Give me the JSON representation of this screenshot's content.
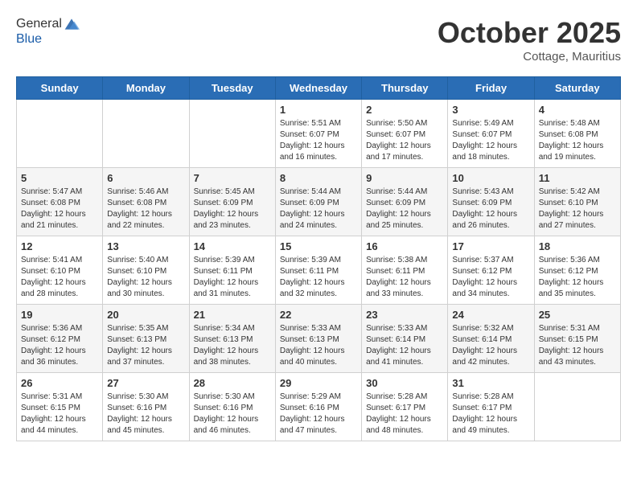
{
  "header": {
    "logo_line1": "General",
    "logo_line2": "Blue",
    "month": "October 2025",
    "location": "Cottage, Mauritius"
  },
  "days_of_week": [
    "Sunday",
    "Monday",
    "Tuesday",
    "Wednesday",
    "Thursday",
    "Friday",
    "Saturday"
  ],
  "weeks": [
    [
      {
        "day": "",
        "info": ""
      },
      {
        "day": "",
        "info": ""
      },
      {
        "day": "",
        "info": ""
      },
      {
        "day": "1",
        "info": "Sunrise: 5:51 AM\nSunset: 6:07 PM\nDaylight: 12 hours\nand 16 minutes."
      },
      {
        "day": "2",
        "info": "Sunrise: 5:50 AM\nSunset: 6:07 PM\nDaylight: 12 hours\nand 17 minutes."
      },
      {
        "day": "3",
        "info": "Sunrise: 5:49 AM\nSunset: 6:07 PM\nDaylight: 12 hours\nand 18 minutes."
      },
      {
        "day": "4",
        "info": "Sunrise: 5:48 AM\nSunset: 6:08 PM\nDaylight: 12 hours\nand 19 minutes."
      }
    ],
    [
      {
        "day": "5",
        "info": "Sunrise: 5:47 AM\nSunset: 6:08 PM\nDaylight: 12 hours\nand 21 minutes."
      },
      {
        "day": "6",
        "info": "Sunrise: 5:46 AM\nSunset: 6:08 PM\nDaylight: 12 hours\nand 22 minutes."
      },
      {
        "day": "7",
        "info": "Sunrise: 5:45 AM\nSunset: 6:09 PM\nDaylight: 12 hours\nand 23 minutes."
      },
      {
        "day": "8",
        "info": "Sunrise: 5:44 AM\nSunset: 6:09 PM\nDaylight: 12 hours\nand 24 minutes."
      },
      {
        "day": "9",
        "info": "Sunrise: 5:44 AM\nSunset: 6:09 PM\nDaylight: 12 hours\nand 25 minutes."
      },
      {
        "day": "10",
        "info": "Sunrise: 5:43 AM\nSunset: 6:09 PM\nDaylight: 12 hours\nand 26 minutes."
      },
      {
        "day": "11",
        "info": "Sunrise: 5:42 AM\nSunset: 6:10 PM\nDaylight: 12 hours\nand 27 minutes."
      }
    ],
    [
      {
        "day": "12",
        "info": "Sunrise: 5:41 AM\nSunset: 6:10 PM\nDaylight: 12 hours\nand 28 minutes."
      },
      {
        "day": "13",
        "info": "Sunrise: 5:40 AM\nSunset: 6:10 PM\nDaylight: 12 hours\nand 30 minutes."
      },
      {
        "day": "14",
        "info": "Sunrise: 5:39 AM\nSunset: 6:11 PM\nDaylight: 12 hours\nand 31 minutes."
      },
      {
        "day": "15",
        "info": "Sunrise: 5:39 AM\nSunset: 6:11 PM\nDaylight: 12 hours\nand 32 minutes."
      },
      {
        "day": "16",
        "info": "Sunrise: 5:38 AM\nSunset: 6:11 PM\nDaylight: 12 hours\nand 33 minutes."
      },
      {
        "day": "17",
        "info": "Sunrise: 5:37 AM\nSunset: 6:12 PM\nDaylight: 12 hours\nand 34 minutes."
      },
      {
        "day": "18",
        "info": "Sunrise: 5:36 AM\nSunset: 6:12 PM\nDaylight: 12 hours\nand 35 minutes."
      }
    ],
    [
      {
        "day": "19",
        "info": "Sunrise: 5:36 AM\nSunset: 6:12 PM\nDaylight: 12 hours\nand 36 minutes."
      },
      {
        "day": "20",
        "info": "Sunrise: 5:35 AM\nSunset: 6:13 PM\nDaylight: 12 hours\nand 37 minutes."
      },
      {
        "day": "21",
        "info": "Sunrise: 5:34 AM\nSunset: 6:13 PM\nDaylight: 12 hours\nand 38 minutes."
      },
      {
        "day": "22",
        "info": "Sunrise: 5:33 AM\nSunset: 6:13 PM\nDaylight: 12 hours\nand 40 minutes."
      },
      {
        "day": "23",
        "info": "Sunrise: 5:33 AM\nSunset: 6:14 PM\nDaylight: 12 hours\nand 41 minutes."
      },
      {
        "day": "24",
        "info": "Sunrise: 5:32 AM\nSunset: 6:14 PM\nDaylight: 12 hours\nand 42 minutes."
      },
      {
        "day": "25",
        "info": "Sunrise: 5:31 AM\nSunset: 6:15 PM\nDaylight: 12 hours\nand 43 minutes."
      }
    ],
    [
      {
        "day": "26",
        "info": "Sunrise: 5:31 AM\nSunset: 6:15 PM\nDaylight: 12 hours\nand 44 minutes."
      },
      {
        "day": "27",
        "info": "Sunrise: 5:30 AM\nSunset: 6:16 PM\nDaylight: 12 hours\nand 45 minutes."
      },
      {
        "day": "28",
        "info": "Sunrise: 5:30 AM\nSunset: 6:16 PM\nDaylight: 12 hours\nand 46 minutes."
      },
      {
        "day": "29",
        "info": "Sunrise: 5:29 AM\nSunset: 6:16 PM\nDaylight: 12 hours\nand 47 minutes."
      },
      {
        "day": "30",
        "info": "Sunrise: 5:28 AM\nSunset: 6:17 PM\nDaylight: 12 hours\nand 48 minutes."
      },
      {
        "day": "31",
        "info": "Sunrise: 5:28 AM\nSunset: 6:17 PM\nDaylight: 12 hours\nand 49 minutes."
      },
      {
        "day": "",
        "info": ""
      }
    ]
  ]
}
